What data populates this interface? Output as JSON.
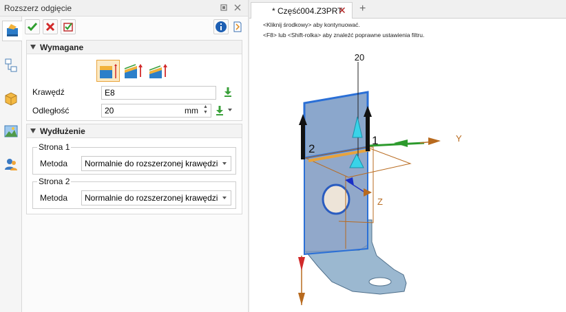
{
  "panel": {
    "title": "Rozszerz odgięcie",
    "pin_icon": "pin-icon",
    "close_icon": "close-icon"
  },
  "side_tabs": [
    "feature-manager-icon",
    "assembly-tree-icon",
    "part-cube-icon",
    "scene-image-icon",
    "user-icon"
  ],
  "toolbar": {
    "ok_icon": "checkmark-icon",
    "cancel_icon": "cross-icon",
    "apply_icon": "apply-check-icon",
    "info_icon": "info-icon",
    "help_icon": "help-book-icon"
  },
  "required": {
    "title": "Wymagane",
    "mode_icons": [
      "extend-height-icon",
      "extend-slant-up-icon",
      "extend-slant-icon"
    ],
    "edge_label": "Krawędź",
    "edge_value": "E8",
    "distance_label": "Odległość",
    "distance_value": "20",
    "distance_unit": "mm"
  },
  "extension": {
    "title": "Wydłużenie",
    "side1_title": "Strona 1",
    "side1_method_label": "Metoda",
    "side1_method_value": "Normalnie do rozszerzonej krawędzi",
    "side2_title": "Strona 2",
    "side2_method_label": "Metoda",
    "side2_method_value": "Normalnie do rozszerzonej krawędzi"
  },
  "document_tab": {
    "label": "* Część004.Z3PRT",
    "add_icon": "plus-icon"
  },
  "hints": [
    "<Kliknij środkowy> aby kontynuować.",
    "<F8> lub <Shift-rolka> aby znaleźć poprawne ustawienia filtru."
  ],
  "viewport_labels": {
    "dimension": "20",
    "side_1": "1",
    "side_2": "2",
    "axis_y": "Y",
    "axis_z": "Z"
  },
  "colors": {
    "accent_orange": "#e8a33a",
    "selected_edge": "#2a6fd6",
    "sheet_blue": "#6f8fb8",
    "axis_orange": "#b86a1e"
  }
}
